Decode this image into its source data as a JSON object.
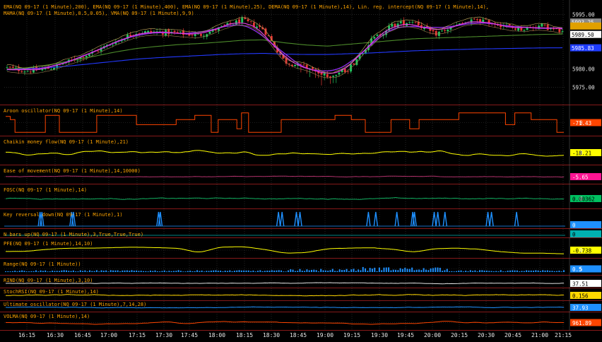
{
  "colors": {
    "background": "#000000",
    "grid": "#3a3a3a",
    "separator": "#b22222",
    "label": "#ffa500",
    "tick_text": "#e8e8e8"
  },
  "chart_data": {
    "type": "line",
    "instrument": "NQ 09-17 (1 Minute)",
    "time_labels": [
      "16:15",
      "16:30",
      "16:45",
      "17:00",
      "17:15",
      "17:30",
      "17:45",
      "18:00",
      "18:15",
      "18:30",
      "18:45",
      "19:00",
      "19:15",
      "19:30",
      "19:45",
      "20:00",
      "20:15",
      "20:30",
      "20:45",
      "21:00",
      "21:15"
    ],
    "panels": [
      {
        "id": "price",
        "type": "candlestick",
        "title": "EMA(NQ 09-17 (1 Minute),200), EMA(NQ 09-17 (1 Minute),400), EMA(NQ 09-17 (1 Minute),25), DEMA(NQ 09-17 (1 Minute),14), Lin. reg. intercept(NQ 09-17 (1 Minute),14), MAMA(NQ 09-17 (1 Minute),0.5,0.05), VMA(NQ 09-17 (1 Minute),9,9)",
        "ylim": [
          5972,
          5997
        ],
        "y_ticks": [
          "5995.00",
          "5980.00",
          "5975.00"
        ],
        "y_tick_values": [
          5995,
          5980,
          5975
        ],
        "badges": [
          {
            "text": "5993.25",
            "value": 5992.9,
            "color": "#8a8a8a"
          },
          {
            "text": "",
            "value": 5991.8,
            "color": "#e0a000"
          },
          {
            "text": "5989.50",
            "value": 5989.5,
            "color": "#ffffff"
          },
          {
            "text": "5985.83",
            "value": 5985.83,
            "color": "#1e3cff"
          }
        ],
        "anchors": {
          "close": [
            5980.3,
            5979.5,
            5980.2,
            5982.3,
            5984.5,
            5987.3,
            5990.0,
            5990.2,
            5989.8,
            5989.3,
            5991.3,
            5993.4,
            5991.0,
            5982.0,
            5980.5,
            5977.8,
            5980.1,
            5987.6,
            5991.9,
            5993.3,
            5989.5,
            5991.8,
            5993.6,
            5992.3,
            5990.9,
            5991.9,
            5990.1
          ],
          "ema200": [
            5980,
            5980.4,
            5981.2,
            5982.3,
            5983.4,
            5984.6,
            5985.6,
            5986.2,
            5986.7,
            5987.0,
            5987.4,
            5987.9,
            5988.0,
            5987.2,
            5986.6,
            5986.3,
            5986.8,
            5987.3,
            5987.8,
            5988.3,
            5988.5,
            5988.7,
            5988.9,
            5989.1,
            5989.3,
            5989.5,
            5989.6
          ],
          "ema400": [
            5980,
            5980.1,
            5980.4,
            5980.9,
            5981.5,
            5982.1,
            5982.7,
            5983.1,
            5983.4,
            5983.7,
            5984.0,
            5984.2,
            5984.3,
            5984.1,
            5984.0,
            5984.0,
            5984.2,
            5984.4,
            5984.7,
            5985.0,
            5985.2,
            5985.35,
            5985.5,
            5985.6,
            5985.7,
            5985.8,
            5985.83
          ]
        }
      },
      {
        "id": "aroon",
        "type": "step",
        "title": "Aroon oscillator(NQ 09-17 (1 Minute),14)",
        "value_text": "-71.43",
        "badge_color": "#ff4500",
        "series_color": "#ff4500",
        "ylim": [
          -100,
          100
        ],
        "zero_label": "0"
      },
      {
        "id": "chaikin",
        "type": "line",
        "title": "Chaikin money flow(NQ 09-17 (1 Minute),21)",
        "value_text": "-18.21",
        "badge_color": "#ffff00",
        "series_color": "#ffff00",
        "ylim": [
          -100,
          100
        ],
        "zero_label": "0"
      },
      {
        "id": "eom",
        "type": "line",
        "title": "Ease of movement(NQ 09-17 (1 Minute),14,10000)",
        "value_text": "-5.65",
        "badge_color": "#ff1493",
        "series_color": "#b0306a",
        "ylim": [
          -100,
          100
        ],
        "zero_label": ""
      },
      {
        "id": "fosc",
        "type": "line",
        "title": "FOSC(NQ 09-17 (1 Minute),14)",
        "value_text": "0.00362",
        "badge_color": "#00c060",
        "series_color": "#10b060",
        "ylim": [
          -100,
          100
        ],
        "zero_label": "0"
      },
      {
        "id": "keyrev",
        "type": "spikes",
        "title": "Key reversal down(NQ 09-17 (1 Minute),1)",
        "value_text": "0",
        "badge_color": "#1e90ff",
        "series_color": "#1e90ff",
        "spike_times": [
          "16:22",
          "16:23",
          "16:39",
          "16:40",
          "17:27",
          "17:28",
          "18:34",
          "18:36",
          "18:44",
          "18:46",
          "19:24",
          "19:28",
          "19:40",
          "19:49",
          "19:50",
          "20:01",
          "20:03",
          "20:07",
          "20:31",
          "20:33",
          "20:47"
        ]
      },
      {
        "id": "nbars",
        "type": "spikes",
        "title": "N bars up(NQ 09-17 (1 Minute),3,True,True,True)",
        "value_text": "0",
        "badge_color": "#00b0b0",
        "series_color": "#00b0b0",
        "spike_times": []
      },
      {
        "id": "pfe",
        "type": "line",
        "title": "PFE(NQ 09-17 (1 Minute),14,10)",
        "value_text": "-0.738",
        "badge_color": "#ffff00",
        "series_color": "#ffff00",
        "ylim": [
          -1,
          1
        ],
        "zero_label": "0",
        "anchors": [
          -0.3,
          -0.2,
          0.2,
          0.4,
          0.4,
          0.5,
          0.6,
          0.5,
          0.4,
          -0.5,
          0.6,
          0.7,
          0.2,
          -0.6,
          -0.5,
          0.3,
          0.4,
          0.5,
          0.2,
          -0.4,
          0.3,
          0.4,
          0.2,
          -0.3,
          -0.6,
          -0.6,
          -0.74
        ]
      },
      {
        "id": "range",
        "type": "bar",
        "title": "Range(NQ 09-17 (1 Minute))",
        "value_text": "0.5",
        "badge_color": "#1e90ff",
        "series_color": "#1e90ff",
        "ylim": [
          0,
          6
        ],
        "zero_label": "5"
      },
      {
        "id": "rind",
        "type": "line",
        "title": "RIND(NQ 09-17 (1 Minute),3,10)",
        "value_text": "37.51",
        "badge_color": "#ffffff",
        "series_color": "#e0e0e0",
        "ylim": [
          0,
          100
        ]
      },
      {
        "id": "stochrsi",
        "type": "line",
        "title": "StochRSI(NQ 09-17 (1 Minute),14)",
        "value_text": "0.156",
        "badge_color": "#ffd700",
        "series_color": "#ffd700",
        "ylim": [
          0,
          1
        ]
      },
      {
        "id": "ultimate",
        "type": "line",
        "title": "Ultimate oscillator(NQ 09-17 (1 Minute),7,14,28)",
        "value_text": "37.93",
        "badge_color": "#1e90ff",
        "series_color": "#1e90ff",
        "ylim": [
          0,
          100
        ]
      },
      {
        "id": "volma",
        "type": "line",
        "title": "VOLMA(NQ 09-17 (1 Minute),14)",
        "value_text": "961.89",
        "badge_color": "#ff4500",
        "series_color": "#ff4500",
        "ylim": [
          0,
          3000
        ]
      }
    ]
  }
}
